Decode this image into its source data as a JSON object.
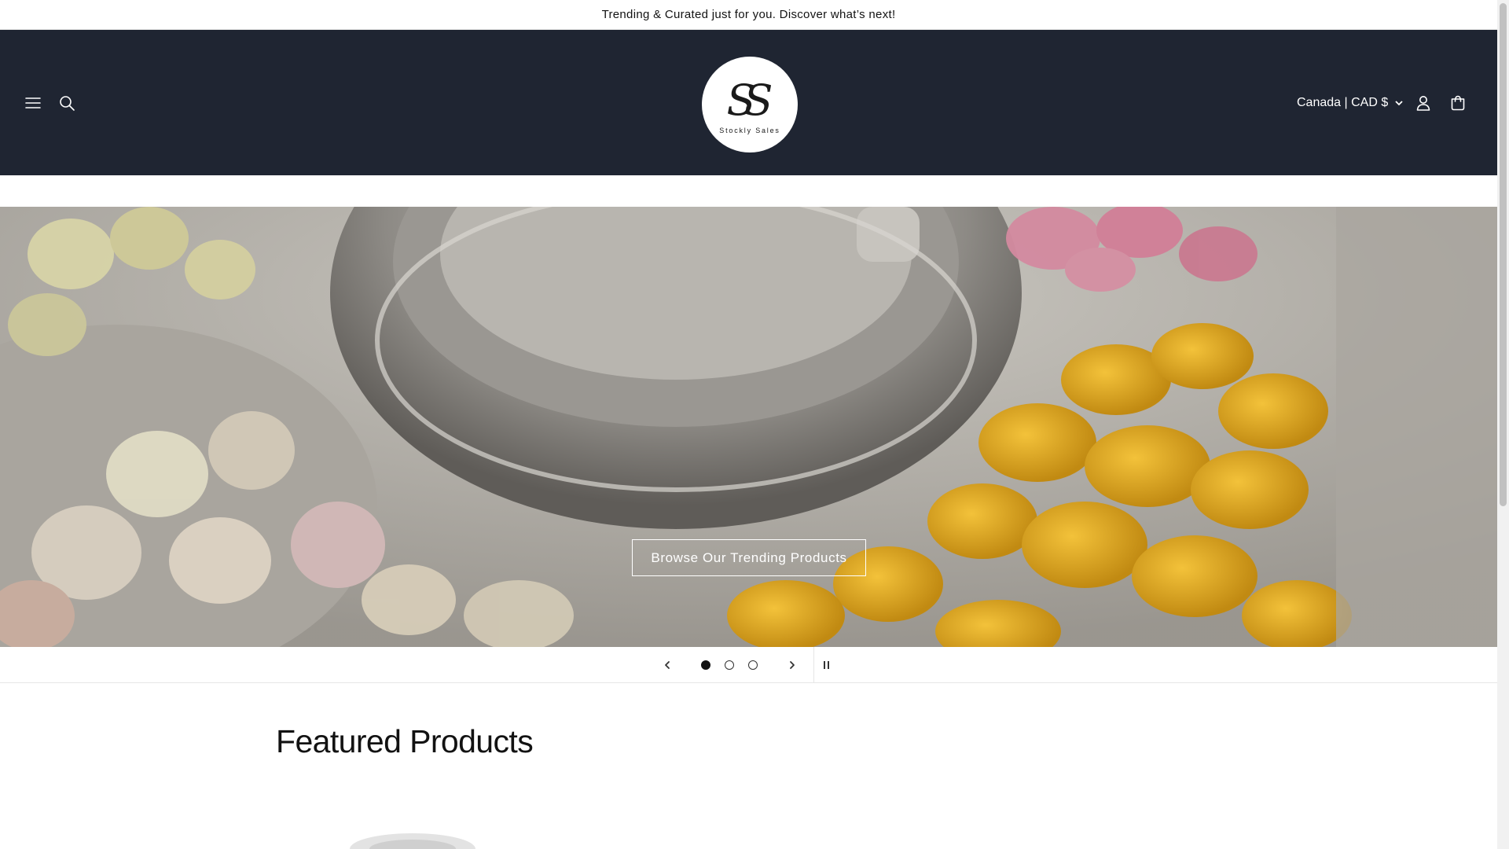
{
  "announcement": {
    "text": "Trending & Curated just for you. Discover what’s next!"
  },
  "header": {
    "logo": {
      "mark": "SS",
      "text": "Stockly Sales"
    },
    "currency_label": "Canada | CAD $",
    "icons": [
      "menu-icon",
      "search-icon",
      "account-icon",
      "cart-icon",
      "chevron-down-icon"
    ],
    "background_color": "#1f2532"
  },
  "hero": {
    "button_label": "Browse Our Trending Products"
  },
  "slideshow": {
    "slide_count": 3,
    "active_slide": 1,
    "icons": [
      "chevron-left-icon",
      "chevron-right-icon",
      "pause-icon"
    ]
  },
  "featured": {
    "title": "Featured Products"
  }
}
